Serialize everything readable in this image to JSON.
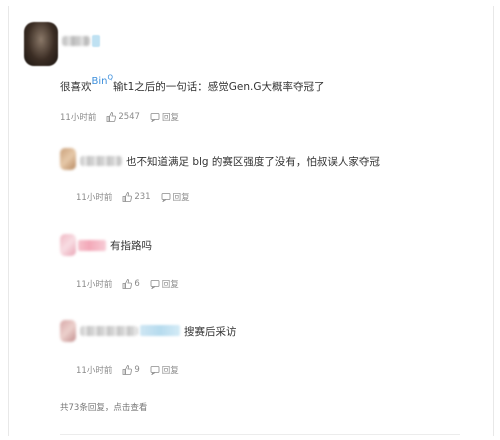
{
  "main_comment": {
    "text_prefix": "很喜欢",
    "mention": "Bin",
    "mention_suffix": "Q",
    "text_suffix": "输t1之后的一句话：感觉Gen.G大概率夺冠了",
    "time": "11小时前",
    "likes": "2547",
    "reply_label": "回复"
  },
  "replies": [
    {
      "text": "也不知道满足 blg 的赛区强度了没有，怕叔误人家夺冠",
      "time": "11小时前",
      "likes": "231",
      "reply_label": "回复"
    },
    {
      "text": "有指路吗",
      "time": "11小时前",
      "likes": "6",
      "reply_label": "回复"
    },
    {
      "text": "搜赛后采访",
      "time": "11小时前",
      "likes": "9",
      "reply_label": "回复"
    }
  ],
  "view_more": "共73条回复，点击查看",
  "colors": {
    "mention": "#3d8fdc",
    "meta": "#8a8a8a",
    "text": "#333333"
  }
}
